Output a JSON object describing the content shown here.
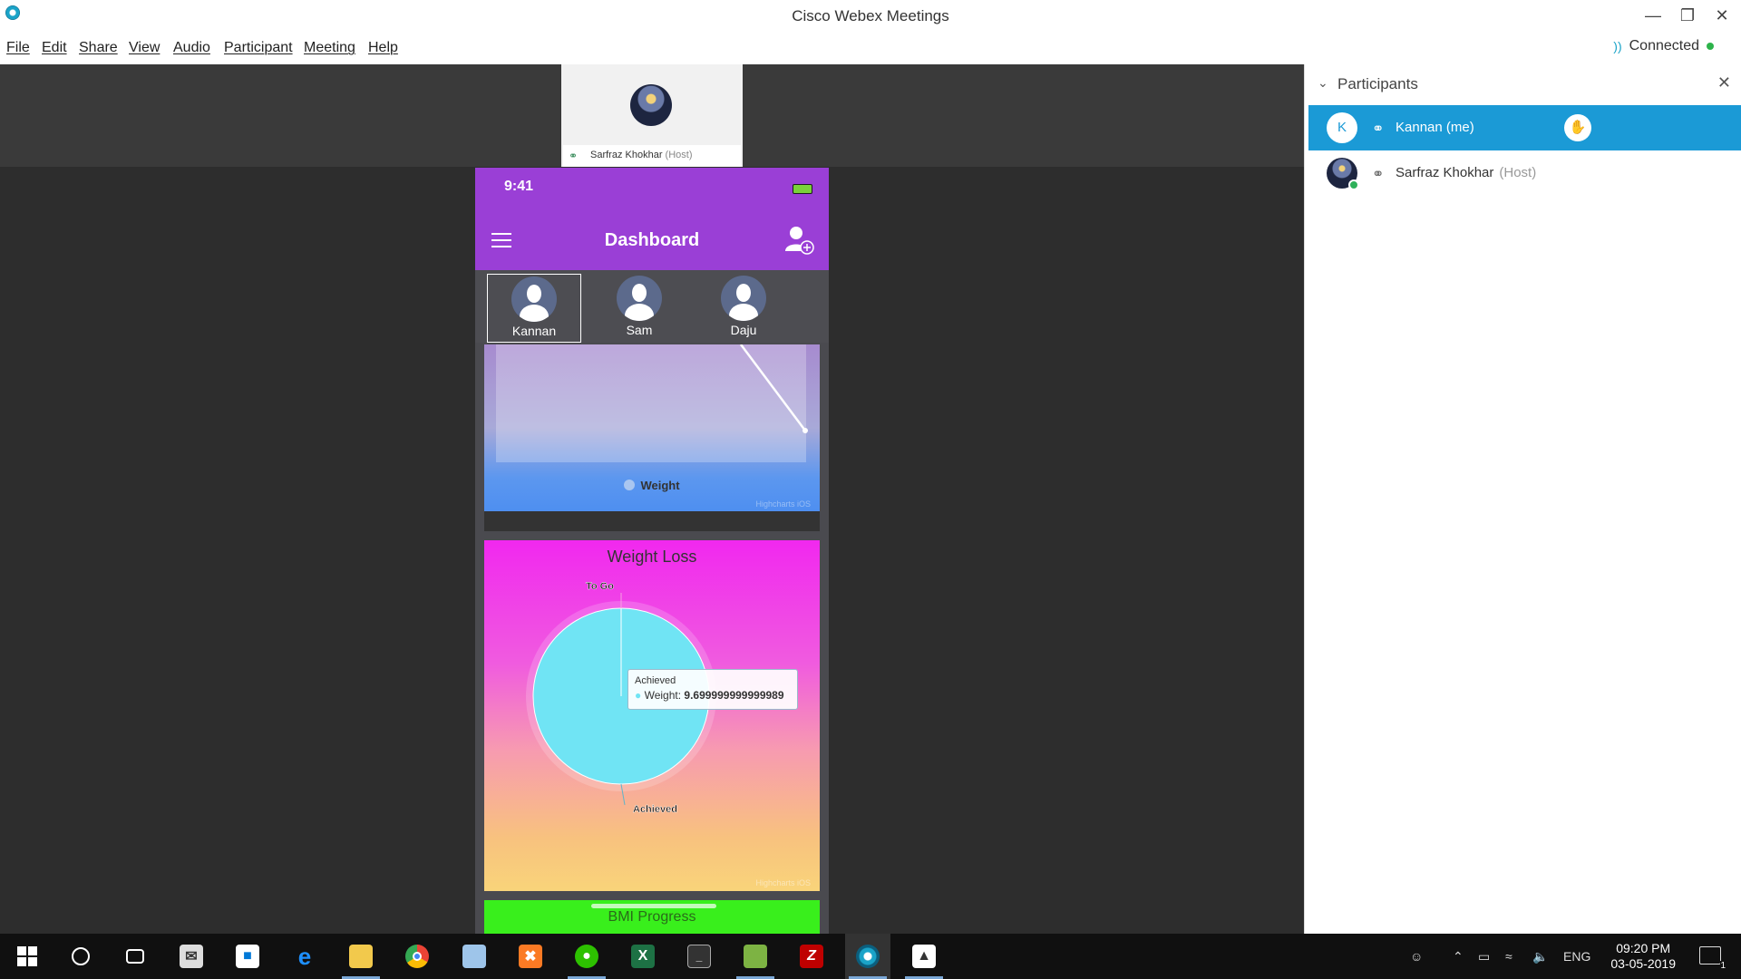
{
  "window": {
    "title": "Cisco Webex Meetings"
  },
  "menu": [
    "File",
    "Edit",
    "Share",
    "View",
    "Audio",
    "Participant",
    "Meeting",
    "Help"
  ],
  "status": {
    "connection": "Connected"
  },
  "host_video": {
    "name": "Sarfraz Khokhar",
    "role": "(Host)"
  },
  "phone": {
    "time": "9:41",
    "header_title": "Dashboard",
    "users": [
      "Kannan",
      "Sam",
      "Daju"
    ],
    "selected_user": "Kannan",
    "bmi_label": "BMI Progress",
    "credit": "Highcharts iOS"
  },
  "chart_data": [
    {
      "type": "area",
      "series": [
        {
          "name": "Weight"
        }
      ],
      "legend": "bottom-center"
    },
    {
      "type": "pie",
      "title": "Weight Loss",
      "categories": [
        "To Go",
        "Achieved"
      ],
      "values": [
        0.0001,
        9.699999999999989
      ],
      "tooltip": {
        "category": "Achieved",
        "series": "Weight",
        "value": "9.699999999999989"
      },
      "colors": {
        "achieved": "#70e4f4"
      }
    }
  ],
  "participants_panel": {
    "title": "Participants",
    "participants": [
      {
        "initial": "K",
        "name": "Kannan",
        "suffix": "(me)",
        "active": true
      },
      {
        "name": "Sarfraz Khokhar",
        "role": "(Host)",
        "active": false
      }
    ]
  },
  "taskbar": {
    "language": "ENG",
    "time": "09:20 PM",
    "date": "03-05-2019",
    "notifications": "1",
    "apps": [
      "start-icon",
      "cortana-icon",
      "task-view-icon",
      "mail-icon",
      "store-icon",
      "edge-icon",
      "file-explorer-icon",
      "chrome-icon",
      "virtualbox-icon",
      "xampp-icon",
      "wechat-icon",
      "excel-icon",
      "terminal-icon",
      "gedit-icon",
      "filezilla-icon",
      "webex-icon",
      "photos-icon"
    ]
  },
  "colors": {
    "accent": "#1b9ad6",
    "phone_header": "#9a3fd6",
    "online": "#2db34a"
  }
}
